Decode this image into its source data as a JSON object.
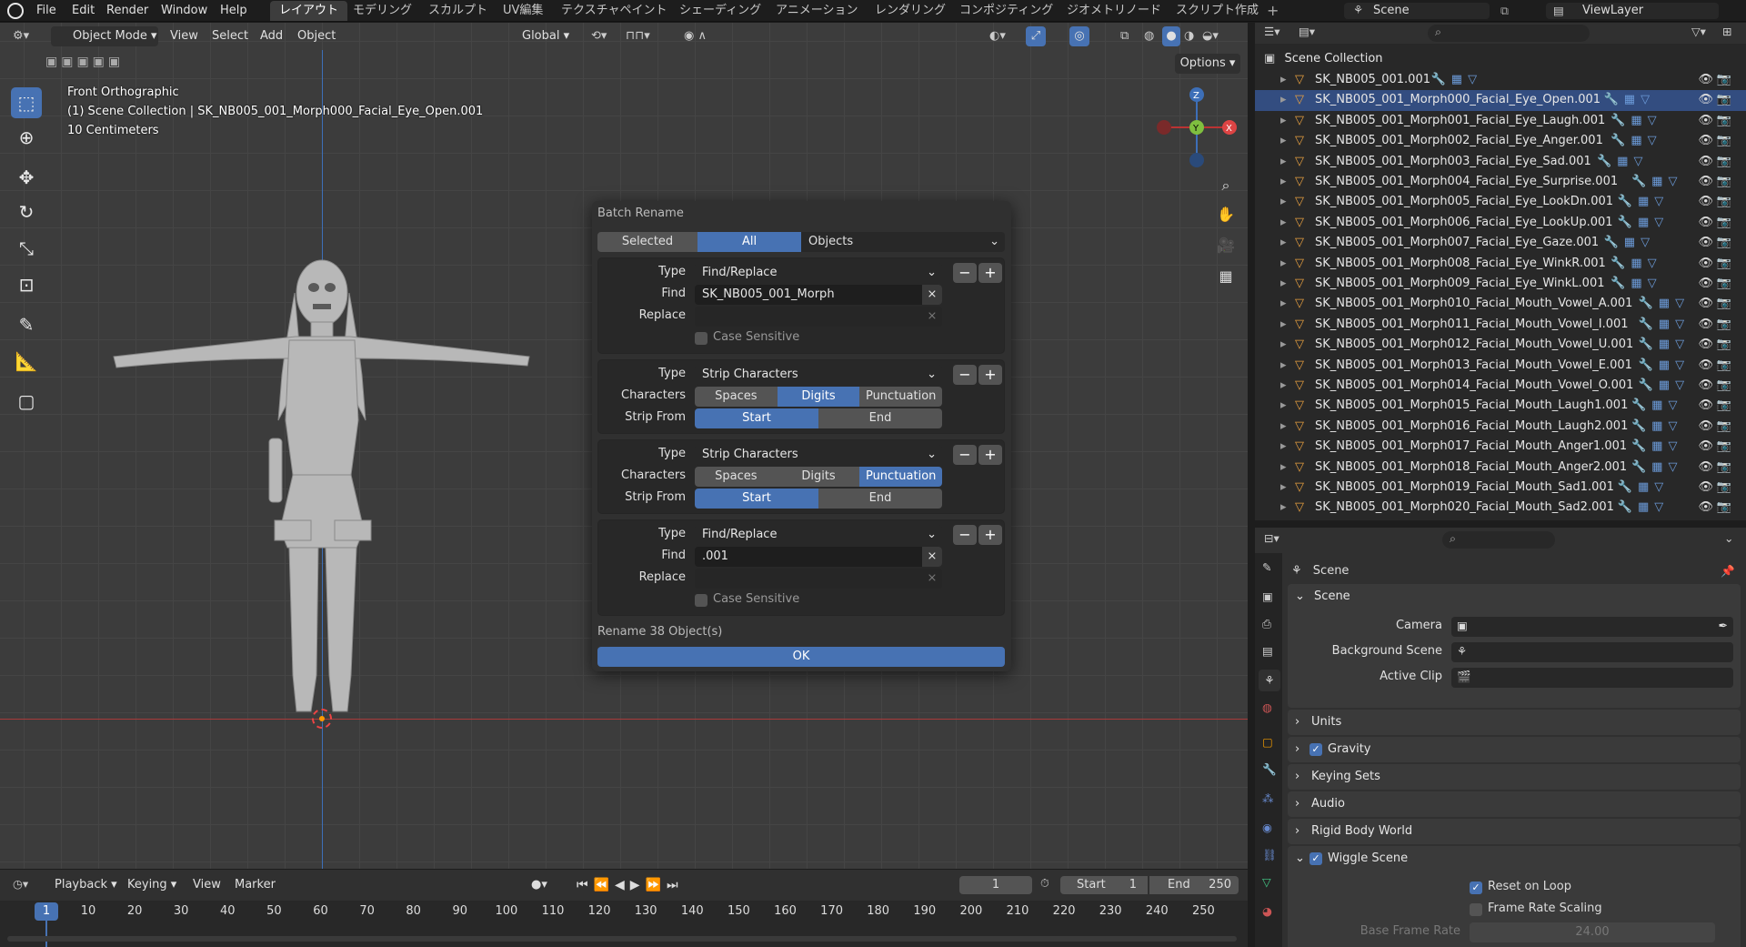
{
  "topbar": {
    "menus": [
      "File",
      "Edit",
      "Render",
      "Window",
      "Help"
    ],
    "workspaces": [
      "レイアウト",
      "モデリング",
      "スカルプト",
      "UV編集",
      "テクスチャペイント",
      "シェーディング",
      "アニメーション",
      "レンダリング",
      "コンポジティング",
      "ジオメトリノード",
      "スクリプト作成"
    ],
    "active_workspace_index": 0,
    "add_tab": "+",
    "scene": "Scene",
    "view_layer": "ViewLayer"
  },
  "viewport": {
    "mode": "Object Mode",
    "menus": [
      "View",
      "Select",
      "Add",
      "Object"
    ],
    "orientation": "Global",
    "options": "Options",
    "view_name": "Front Orthographic",
    "collection_line": "(1) Scene Collection | SK_NB005_001_Morph000_Facial_Eye_Open.001",
    "scale": "10 Centimeters",
    "gizmo": {
      "z": "Z",
      "y": "Y",
      "x": "X"
    }
  },
  "dialog": {
    "title": "Batch Rename",
    "scope_tabs": [
      "Selected",
      "All"
    ],
    "scope_active": "All",
    "data_type": "Objects",
    "steps": [
      {
        "type_label": "Type",
        "type": "Find/Replace",
        "find_label": "Find",
        "find": "SK_NB005_001_Morph",
        "replace_label": "Replace",
        "replace": "",
        "case_label": "Case Sensitive"
      },
      {
        "type_label": "Type",
        "type": "Strip Characters",
        "chars_label": "Characters",
        "chars": [
          "Spaces",
          "Digits",
          "Punctuation"
        ],
        "chars_on": "Digits",
        "strip_label": "Strip From",
        "strip": [
          "Start",
          "End"
        ],
        "strip_on": "Start"
      },
      {
        "type_label": "Type",
        "type": "Strip Characters",
        "chars_label": "Characters",
        "chars": [
          "Spaces",
          "Digits",
          "Punctuation"
        ],
        "chars_on": "Punctuation",
        "strip_label": "Strip From",
        "strip": [
          "Start",
          "End"
        ],
        "strip_on": "Start"
      },
      {
        "type_label": "Type",
        "type": "Find/Replace",
        "find_label": "Find",
        "find": ".001",
        "replace_label": "Replace",
        "replace": "",
        "case_label": "Case Sensitive"
      }
    ],
    "minus": "−",
    "plus": "+",
    "status": "Rename 38 Object(s)",
    "ok": "OK"
  },
  "outliner": {
    "root": "Scene Collection",
    "items": [
      "SK_NB005_001.001",
      "SK_NB005_001_Morph000_Facial_Eye_Open.001",
      "SK_NB005_001_Morph001_Facial_Eye_Laugh.001",
      "SK_NB005_001_Morph002_Facial_Eye_Anger.001",
      "SK_NB005_001_Morph003_Facial_Eye_Sad.001",
      "SK_NB005_001_Morph004_Facial_Eye_Surprise.001",
      "SK_NB005_001_Morph005_Facial_Eye_LookDn.001",
      "SK_NB005_001_Morph006_Facial_Eye_LookUp.001",
      "SK_NB005_001_Morph007_Facial_Eye_Gaze.001",
      "SK_NB005_001_Morph008_Facial_Eye_WinkR.001",
      "SK_NB005_001_Morph009_Facial_Eye_WinkL.001",
      "SK_NB005_001_Morph010_Facial_Mouth_Vowel_A.001",
      "SK_NB005_001_Morph011_Facial_Mouth_Vowel_I.001",
      "SK_NB005_001_Morph012_Facial_Mouth_Vowel_U.001",
      "SK_NB005_001_Morph013_Facial_Mouth_Vowel_E.001",
      "SK_NB005_001_Morph014_Facial_Mouth_Vowel_O.001",
      "SK_NB005_001_Morph015_Facial_Mouth_Laugh1.001",
      "SK_NB005_001_Morph016_Facial_Mouth_Laugh2.001",
      "SK_NB005_001_Morph017_Facial_Mouth_Anger1.001",
      "SK_NB005_001_Morph018_Facial_Mouth_Anger2.001",
      "SK_NB005_001_Morph019_Facial_Mouth_Sad1.001",
      "SK_NB005_001_Morph020_Facial_Mouth_Sad2.001"
    ]
  },
  "properties": {
    "context": "Scene",
    "panel": "Scene",
    "camera_label": "Camera",
    "bg_scene_label": "Background Scene",
    "active_clip_label": "Active Clip",
    "sections": [
      "Units",
      "Gravity",
      "Keying Sets",
      "Audio",
      "Rigid Body World",
      "Wiggle Scene"
    ],
    "wiggle": {
      "reset_on_loop": "Reset on Loop",
      "frame_rate_scaling": "Frame Rate Scaling",
      "base_frame_rate_label": "Base Frame Rate",
      "base_frame_rate": "24.00"
    }
  },
  "timeline": {
    "menus": [
      "Playback",
      "Keying",
      "View",
      "Marker"
    ],
    "current_frame": "1",
    "start_label": "Start",
    "start": "1",
    "end_label": "End",
    "end": "250",
    "ticks": [
      "1",
      "10",
      "20",
      "30",
      "40",
      "50",
      "60",
      "70",
      "80",
      "90",
      "100",
      "110",
      "120",
      "130",
      "140",
      "150",
      "160",
      "170",
      "180",
      "190",
      "200",
      "210",
      "220",
      "230",
      "240",
      "250"
    ]
  },
  "colors": {
    "accent": "#4772b3",
    "bg": "#303030",
    "panel": "#282828",
    "viewport": "#3c3c3c"
  }
}
